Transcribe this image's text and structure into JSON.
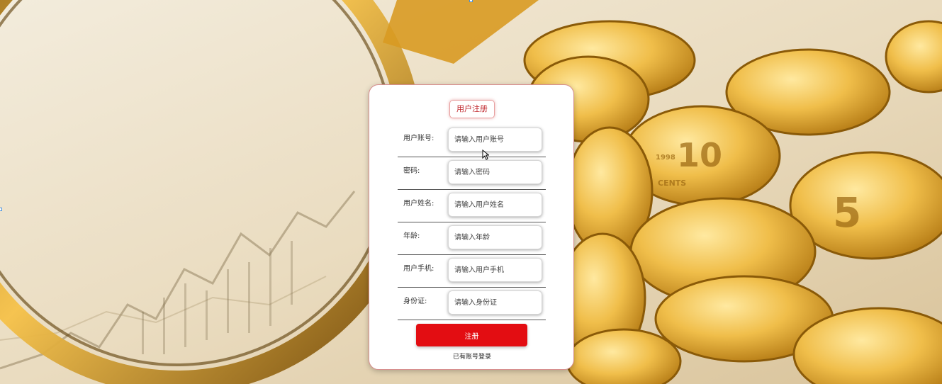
{
  "form": {
    "title": "用户注册",
    "fields": [
      {
        "label": "用户账号:",
        "placeholder": "请输入用户账号"
      },
      {
        "label": "密码:",
        "placeholder": "请输入密码"
      },
      {
        "label": "用户姓名:",
        "placeholder": "请输入用户姓名"
      },
      {
        "label": "年龄:",
        "placeholder": "请输入年龄"
      },
      {
        "label": "用户手机:",
        "placeholder": "请输入用户手机"
      },
      {
        "label": "身份证:",
        "placeholder": "请输入身份证"
      }
    ],
    "submit_label": "注册",
    "login_link": "已有账号登录"
  },
  "colors": {
    "accent": "#e30d12",
    "title_text": "#c0272d",
    "background": "#e9dcc2"
  },
  "background_image": {
    "description": "gold coins, magnifying glass and stock chart",
    "coin_texts": [
      "10",
      "5",
      "1998",
      "CENTS"
    ]
  }
}
